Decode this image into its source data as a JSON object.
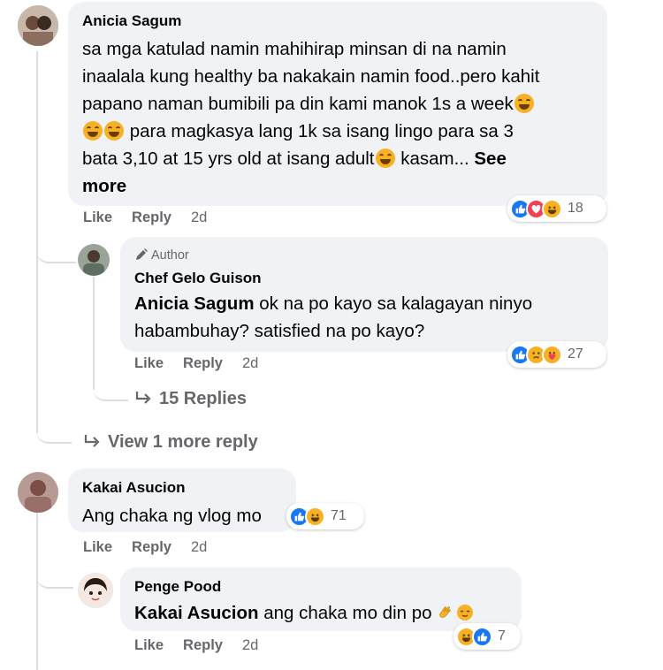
{
  "comments": [
    {
      "author": "Anicia Sagum",
      "text_lines": [
        "sa mga katulad namin mahihirap minsan di na namin",
        "inaalala kung healthy ba nakakain namin food..pero kahit",
        "papano naman bumibili pa din kami manok 1s a week",
        " para magkasya lang 1k sa isang lingo para sa 3",
        "bata 3,10 at 15 yrs old at isang adult",
        " kasam... "
      ],
      "see_more": "See",
      "see_more_2": "more",
      "like": "Like",
      "reply": "Reply",
      "time": "2d",
      "reaction_count": "18",
      "reactions": [
        "like-icon",
        "love-icon",
        "haha-icon"
      ]
    },
    {
      "author_badge": "Author",
      "author": "Chef Gelo Guison",
      "mention": "Anicia Sagum",
      "text_1": " ok na po kayo sa kalagayan ninyo",
      "text_2": "habambuhay? satisfied na po kayo?",
      "like": "Like",
      "reply": "Reply",
      "time": "2d",
      "reaction_count": "27",
      "reactions": [
        "like-icon",
        "sad-icon",
        "care-icon"
      ],
      "replies_link": "15 Replies"
    },
    {
      "view_more": "View 1 more reply"
    },
    {
      "author": "Kakai Asucion",
      "text": "Ang chaka ng vlog mo",
      "like": "Like",
      "reply": "Reply",
      "time": "2d",
      "reaction_count": "71",
      "reactions": [
        "like-icon",
        "haha-icon"
      ]
    },
    {
      "author": "Penge Pood",
      "mention": "Kakai Asucion",
      "text": " ang chaka mo din po ",
      "like": "Like",
      "reply": "Reply",
      "time": "2d",
      "reaction_count": "7",
      "reactions": [
        "haha-icon",
        "like-icon"
      ]
    }
  ],
  "colors": {
    "bubble": "#f0f2f5",
    "secondary_text": "#65676b",
    "like_blue": "#1877f2",
    "love_red": "#f33e58",
    "emoji_yellow": "#f7b125"
  }
}
